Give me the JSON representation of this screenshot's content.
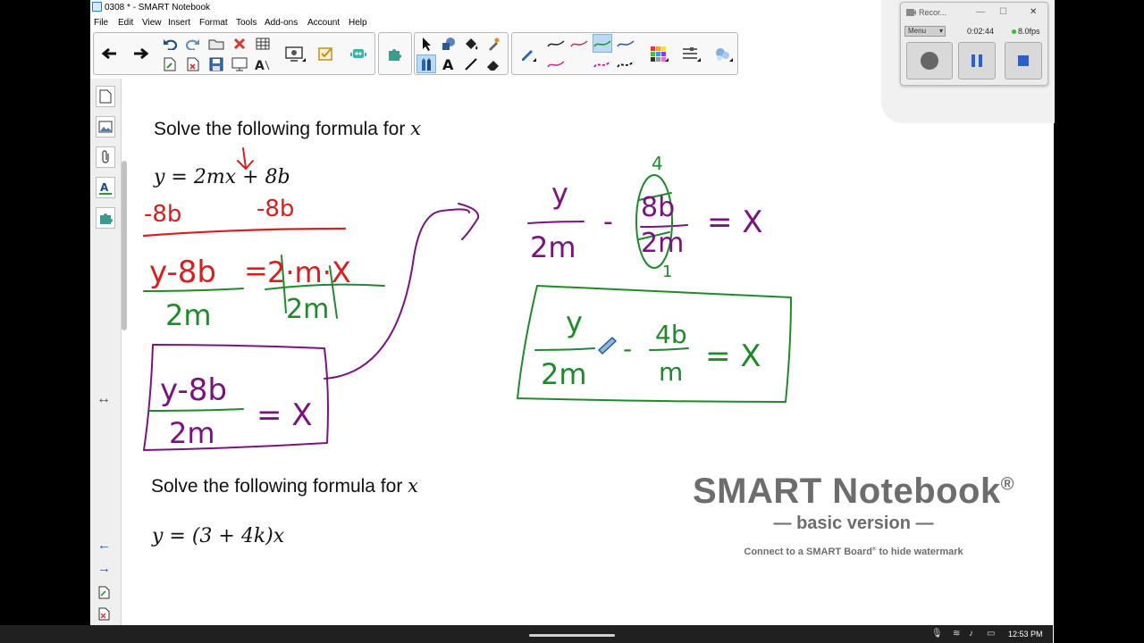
{
  "window": {
    "title": "0308 * - SMART Notebook"
  },
  "menu": [
    "File",
    "Edit",
    "View",
    "Insert",
    "Format",
    "Tools",
    "Add-ons",
    "Account",
    "Help"
  ],
  "canvas": {
    "problem1": {
      "prompt": "Solve the following formula for",
      "variable": "x",
      "equation": "y = 2mx + 8b"
    },
    "problem2": {
      "prompt": "Solve the following formula for",
      "variable": "x",
      "equation": "y = (3 + 4k)x"
    },
    "handwriting": {
      "sub_left": "-8b",
      "sub_right": "-8b",
      "step1_left": "y-8b",
      "step1_eq": "=",
      "step1_right": "2·m·X",
      "step1_den_left": "2m",
      "step1_den_right": "2m",
      "boxed_num": "y-8b",
      "boxed_den": "2m",
      "boxed_eq": "= X",
      "split_y": "y",
      "split_2m": "2m",
      "split_minus": "-",
      "split_8b": "8b",
      "split_2m_b": "2m",
      "split_eq": "= X",
      "cancel_top": "4",
      "cancel_bottom": "1",
      "final_y": "y",
      "final_2m": "2m",
      "final_minus": "-",
      "final_4b": "4b",
      "final_m": "m",
      "final_eq": "= X"
    }
  },
  "watermark": {
    "brand": "SMART Notebook",
    "reg": "®",
    "edition": "— basic version —",
    "note": "Connect to a SMART Board",
    "note_sup": "®",
    "note_tail": " to hide watermark"
  },
  "recorder": {
    "title": "Recor...",
    "menu": "Menu",
    "timer": "0:02:44",
    "fps": "8.0fps"
  },
  "taskbar": {
    "time": "12:53 PM"
  },
  "colors": {
    "red_ink": "#d81e1e",
    "green_ink": "#1f8a2a",
    "purple_ink": "#7a1380"
  }
}
